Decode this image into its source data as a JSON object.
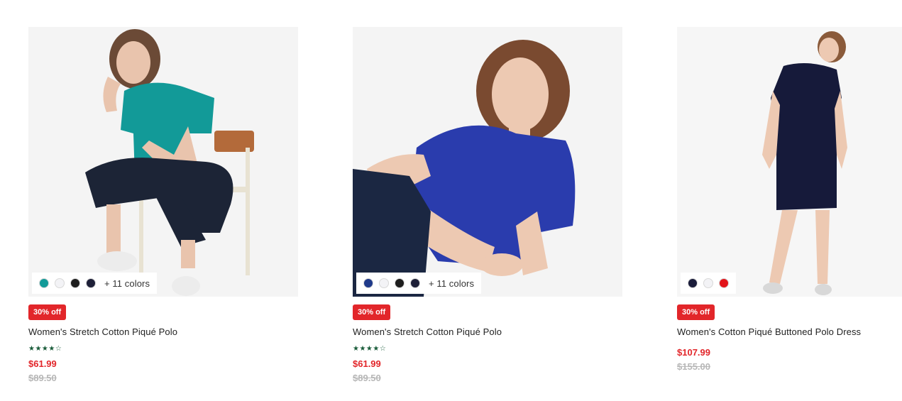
{
  "products": [
    {
      "title": "Women's Stretch Cotton Piqué Polo",
      "badge": "30% off",
      "rating_stars": "★★★★☆",
      "price": "$61.99",
      "old_price": "$89.50",
      "swatches": [
        "#129a98",
        "#f3f3f6",
        "#1e1e1e",
        "#1e2038"
      ],
      "more_colors": "+ 11 colors",
      "image_icon": "model-green-polo-image"
    },
    {
      "title": "Women's Stretch Cotton Piqué Polo",
      "badge": "30% off",
      "rating_stars": "★★★★☆",
      "price": "$61.99",
      "old_price": "$89.50",
      "swatches": [
        "#1f3a8a",
        "#f3f3f6",
        "#1e1e1e",
        "#1e2038"
      ],
      "more_colors": "+ 11 colors",
      "image_icon": "model-blue-polo-image"
    },
    {
      "title": "Women's Cotton Piqué Buttoned Polo Dress",
      "badge": "30% off",
      "price": "$107.99",
      "old_price": "$155.00",
      "swatches": [
        "#1a1c3a",
        "#f3f3f6",
        "#e2141a"
      ],
      "image_icon": "model-navy-dress-image"
    }
  ],
  "colors": {
    "accent_red": "#e2262a",
    "rating_green": "#1a5c3a",
    "muted_gray": "#b7b7b7"
  }
}
